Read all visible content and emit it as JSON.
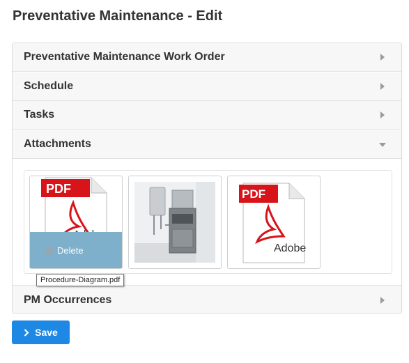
{
  "page": {
    "title": "Preventative Maintenance - Edit"
  },
  "sections": [
    {
      "label": "Preventative Maintenance Work Order",
      "expanded": false
    },
    {
      "label": "Schedule",
      "expanded": false
    },
    {
      "label": "Tasks",
      "expanded": false
    },
    {
      "label": "Attachments",
      "expanded": true
    },
    {
      "label": "PM Occurrences",
      "expanded": false
    }
  ],
  "attachments": {
    "items": [
      {
        "type": "pdf",
        "icon": "adobe-pdf-icon",
        "pdf_label": "PDF",
        "brand": "Adobe",
        "hovered": true,
        "delete_label": "Delete"
      },
      {
        "type": "image",
        "icon": "water-heater-photo"
      },
      {
        "type": "pdf",
        "icon": "adobe-pdf-icon",
        "pdf_label": "PDF",
        "brand": "Adobe"
      }
    ],
    "tooltip": "Procedure-Diagram.pdf"
  },
  "actions": {
    "save_label": "Save"
  },
  "colors": {
    "primary": "#1e88e5",
    "overlay": "#7eb0cb",
    "pdf_red": "#d7141a"
  }
}
